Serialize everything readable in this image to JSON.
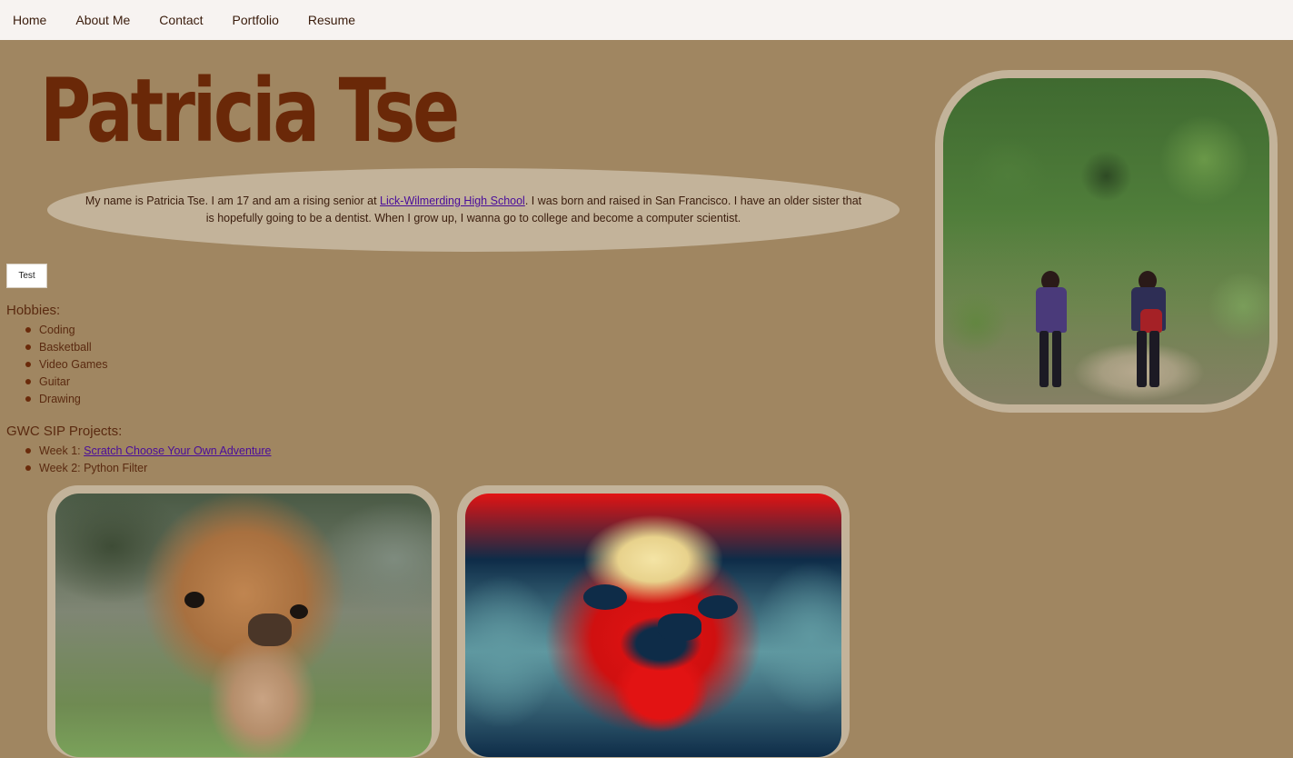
{
  "nav": {
    "items": [
      {
        "label": "Home"
      },
      {
        "label": "About Me"
      },
      {
        "label": "Contact"
      },
      {
        "label": "Portfolio"
      },
      {
        "label": "Resume"
      }
    ]
  },
  "header": {
    "title": "Patricia Tse"
  },
  "intro": {
    "text_before": "My name is Patricia Tse. I am 17 and am a rising senior at ",
    "school_link": "Lick-Wilmerding High School",
    "text_after": ". I was born and raised in San Francisco. I have an older sister that is hopefully going to be a dentist. When I grow up, I wanna go to college and become a computer scientist."
  },
  "test_button": {
    "label": "Test"
  },
  "hobbies": {
    "heading": "Hobbies:",
    "items": [
      "Coding",
      "Basketball",
      "Video Games",
      "Guitar",
      "Drawing"
    ]
  },
  "projects": {
    "heading": "GWC SIP Projects:",
    "items": [
      {
        "prefix": "Week 1: ",
        "link": "Scratch Choose Your Own Adventure"
      },
      {
        "prefix": "Week 2: Python Filter",
        "link": ""
      }
    ]
  },
  "colors": {
    "page_background": "#a08661",
    "navbar_background": "#f7f3f1",
    "title_color": "#6a2808",
    "frame_color": "#c3b39a",
    "link_color": "#4a0d9a"
  }
}
